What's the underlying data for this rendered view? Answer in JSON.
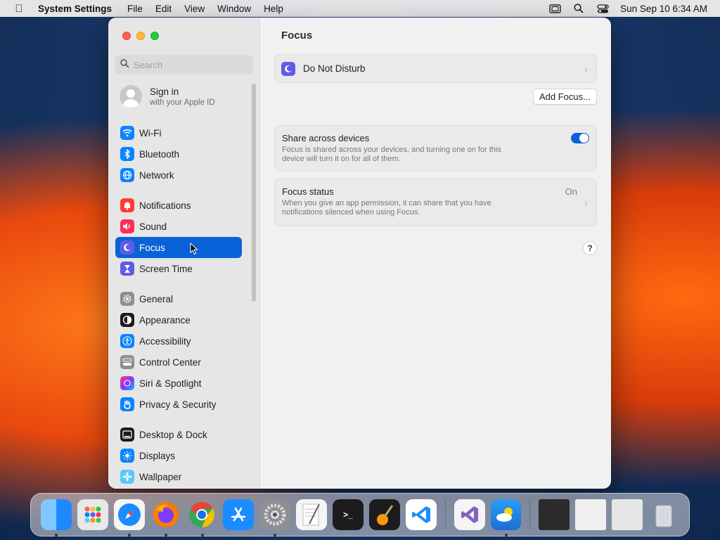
{
  "menubar": {
    "app_name": "System Settings",
    "menus": [
      "File",
      "Edit",
      "View",
      "Window",
      "Help"
    ],
    "clock": "Sun Sep 10  6:34 AM"
  },
  "sidebar": {
    "search_placeholder": "Search",
    "signin_title": "Sign in",
    "signin_subtitle": "with your Apple ID",
    "items": [
      {
        "label": "Wi-Fi",
        "icon": "wifi-icon",
        "color": "#0a84ff"
      },
      {
        "label": "Bluetooth",
        "icon": "bluetooth-icon",
        "color": "#0a84ff"
      },
      {
        "label": "Network",
        "icon": "globe-icon",
        "color": "#0a84ff"
      },
      {
        "label": "Notifications",
        "icon": "bell-icon",
        "color": "#ff3b30"
      },
      {
        "label": "Sound",
        "icon": "speaker-icon",
        "color": "#ff2d55"
      },
      {
        "label": "Focus",
        "icon": "moon-icon",
        "color": "#5e5ce6"
      },
      {
        "label": "Screen Time",
        "icon": "hourglass-icon",
        "color": "#5e5ce6"
      },
      {
        "label": "General",
        "icon": "gear-icon",
        "color": "#8e8e93"
      },
      {
        "label": "Appearance",
        "icon": "appearance-icon",
        "color": "#1c1c1e"
      },
      {
        "label": "Accessibility",
        "icon": "accessibility-icon",
        "color": "#0a84ff"
      },
      {
        "label": "Control Center",
        "icon": "control-center-icon",
        "color": "#8e8e93"
      },
      {
        "label": "Siri & Spotlight",
        "icon": "siri-icon",
        "color": "#7a3cff"
      },
      {
        "label": "Privacy & Security",
        "icon": "hand-icon",
        "color": "#0a84ff"
      },
      {
        "label": "Desktop & Dock",
        "icon": "dock-icon",
        "color": "#1c1c1e"
      },
      {
        "label": "Displays",
        "icon": "sun-icon",
        "color": "#0a84ff"
      },
      {
        "label": "Wallpaper",
        "icon": "wallpaper-icon",
        "color": "#5ac8fa"
      }
    ],
    "active": "Focus"
  },
  "content": {
    "title": "Focus",
    "dnd_label": "Do Not Disturb",
    "add_focus_label": "Add Focus...",
    "share_title": "Share across devices",
    "share_desc": "Focus is shared across your devices, and turning one on for this device will turn it on for all of them.",
    "share_enabled": true,
    "status_title": "Focus status",
    "status_value": "On",
    "status_desc": "When you give an app permission, it can share that you have notifications silenced when using Focus.",
    "help_label": "?"
  },
  "dock": {
    "apps": [
      {
        "name": "finder-icon",
        "color": "#1e88ff",
        "running": true
      },
      {
        "name": "launchpad-icon",
        "color": "#e8e8e8",
        "running": false
      },
      {
        "name": "safari-icon",
        "color": "#1a8cff",
        "running": true
      },
      {
        "name": "firefox-icon",
        "color": "#ff7b00",
        "running": true
      },
      {
        "name": "chrome-icon",
        "color": "#ffffff",
        "running": true
      },
      {
        "name": "app-store-icon",
        "color": "#1a8cff",
        "running": false
      },
      {
        "name": "system-settings-icon",
        "color": "#8e8e93",
        "running": true
      },
      {
        "name": "textedit-icon",
        "color": "#f5f5f5",
        "running": false
      },
      {
        "name": "terminal-icon",
        "color": "#1c1c1e",
        "running": false
      },
      {
        "name": "garageband-icon",
        "color": "#1c1c1e",
        "running": false
      },
      {
        "name": "vscode-icon",
        "color": "#ffffff",
        "running": false
      },
      {
        "name": "visual-studio-icon",
        "color": "#f5f5f5",
        "running": false
      },
      {
        "name": "weather-icon",
        "color": "#2a9df4",
        "running": true
      },
      {
        "name": "recent-window-1-icon",
        "color": "#2b2b2b",
        "running": false
      },
      {
        "name": "recent-window-2-icon",
        "color": "#f0f0f0",
        "running": false
      },
      {
        "name": "recent-window-3-icon",
        "color": "#e6e6e6",
        "running": false
      },
      {
        "name": "trash-icon",
        "color": "#e8e8e8",
        "running": false
      }
    ]
  }
}
